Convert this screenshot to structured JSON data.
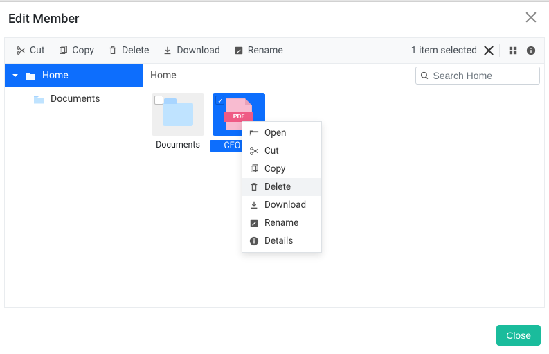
{
  "dialog": {
    "title": "Edit Member"
  },
  "toolbar": {
    "cut": "Cut",
    "copy": "Copy",
    "delete": "Delete",
    "download": "Download",
    "rename": "Rename",
    "status": "1 item selected"
  },
  "tree": {
    "home": "Home",
    "documents": "Documents"
  },
  "breadcrumb": {
    "path": "Home"
  },
  "search": {
    "placeholder": "Search Home"
  },
  "items": {
    "documents": "Documents",
    "pdf": "CEO R…",
    "pdf_badge": "PDF"
  },
  "ctx": {
    "open": "Open",
    "cut": "Cut",
    "copy": "Copy",
    "delete": "Delete",
    "download": "Download",
    "rename": "Rename",
    "details": "Details"
  },
  "footer": {
    "close": "Close"
  }
}
